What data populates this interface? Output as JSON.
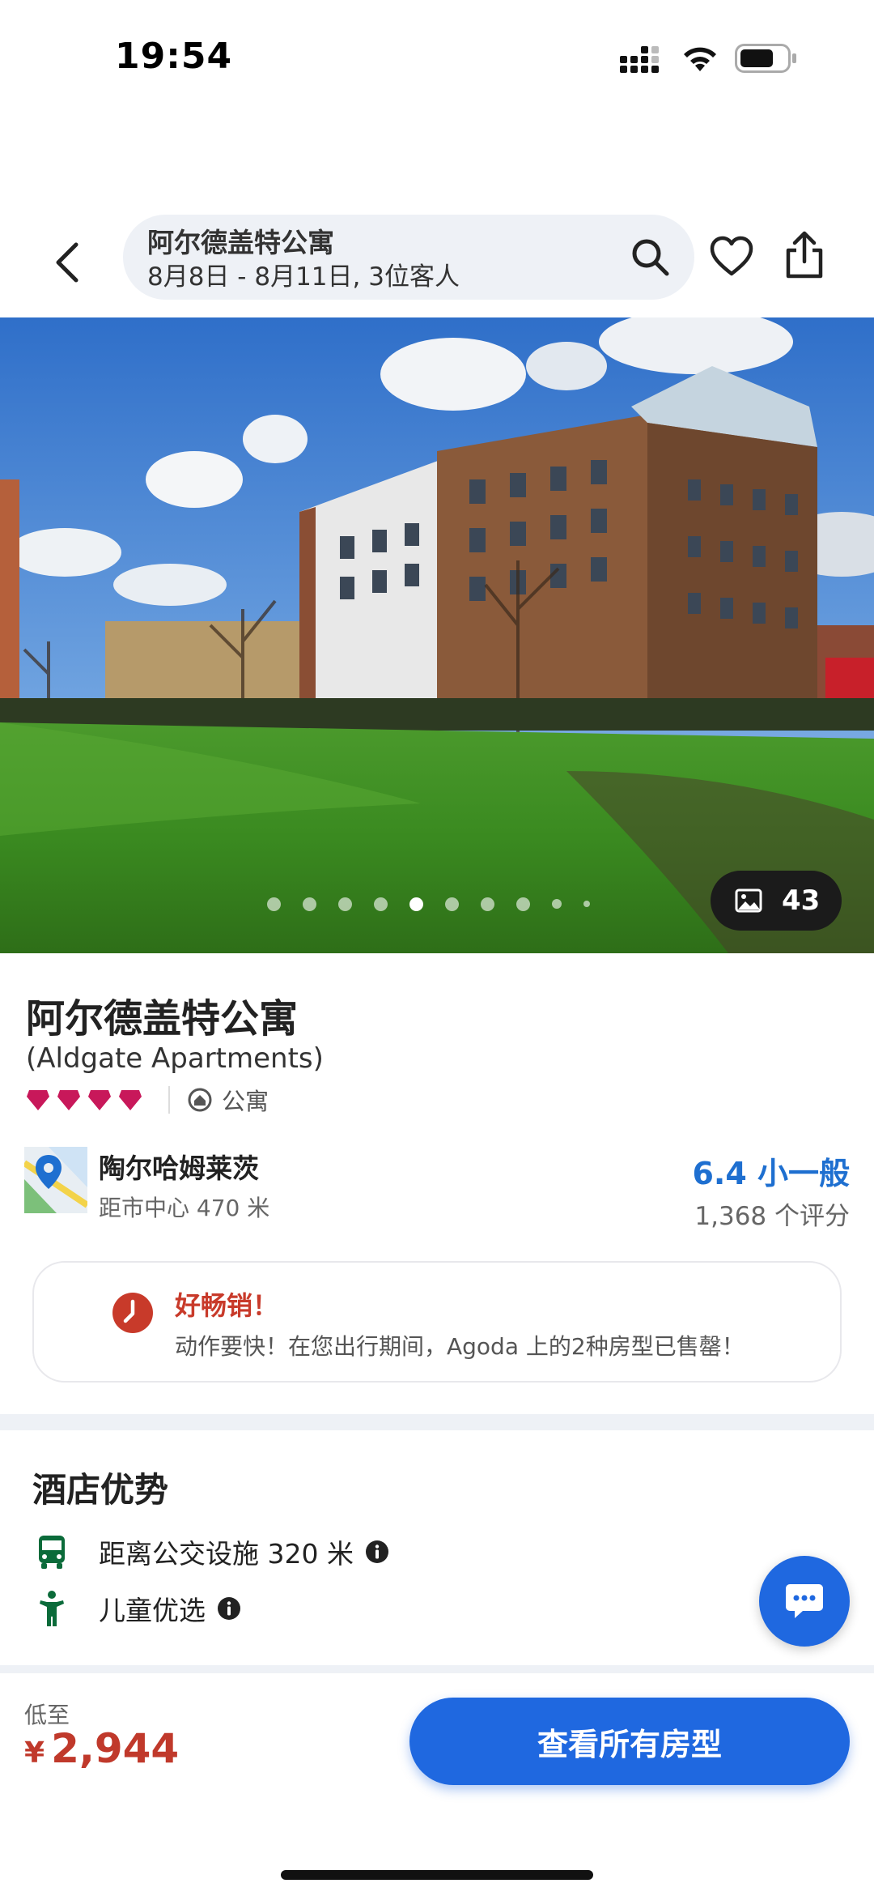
{
  "status_bar": {
    "time": "19:54"
  },
  "header": {
    "title": "阿尔德盖特公寓",
    "subtitle": "8月8日 - 8月11日, 3位客人"
  },
  "gallery": {
    "photo_count": "43",
    "total_dots": 10,
    "active_dot_index": 4
  },
  "property": {
    "name": "阿尔德盖特公寓",
    "english_name": "(Aldgate Apartments)",
    "gem_rating": 4,
    "type": "公寓",
    "area": "陶尔哈姆莱茨",
    "distance": "距市中心 470 米",
    "score_text": "6.4 小一般",
    "reviews_text": "1,368 个评分"
  },
  "alert": {
    "title": "好畅销！",
    "body": "动作要快！在您出行期间，Agoda 上的2种房型已售罄！"
  },
  "highlights": {
    "title": "酒店优势",
    "items": [
      {
        "label": "距离公交设施 320 米",
        "icon": "bus-icon"
      },
      {
        "label": "儿童优选",
        "icon": "child-icon"
      }
    ]
  },
  "footer": {
    "price_label": "低至",
    "currency": "¥",
    "price": "2,944",
    "cta_label": "查看所有房型"
  },
  "colors": {
    "accent_blue": "#1f68e0",
    "score_blue": "#1e6fd0",
    "price_red": "#c0392b",
    "gem_pink": "#c8185a"
  }
}
